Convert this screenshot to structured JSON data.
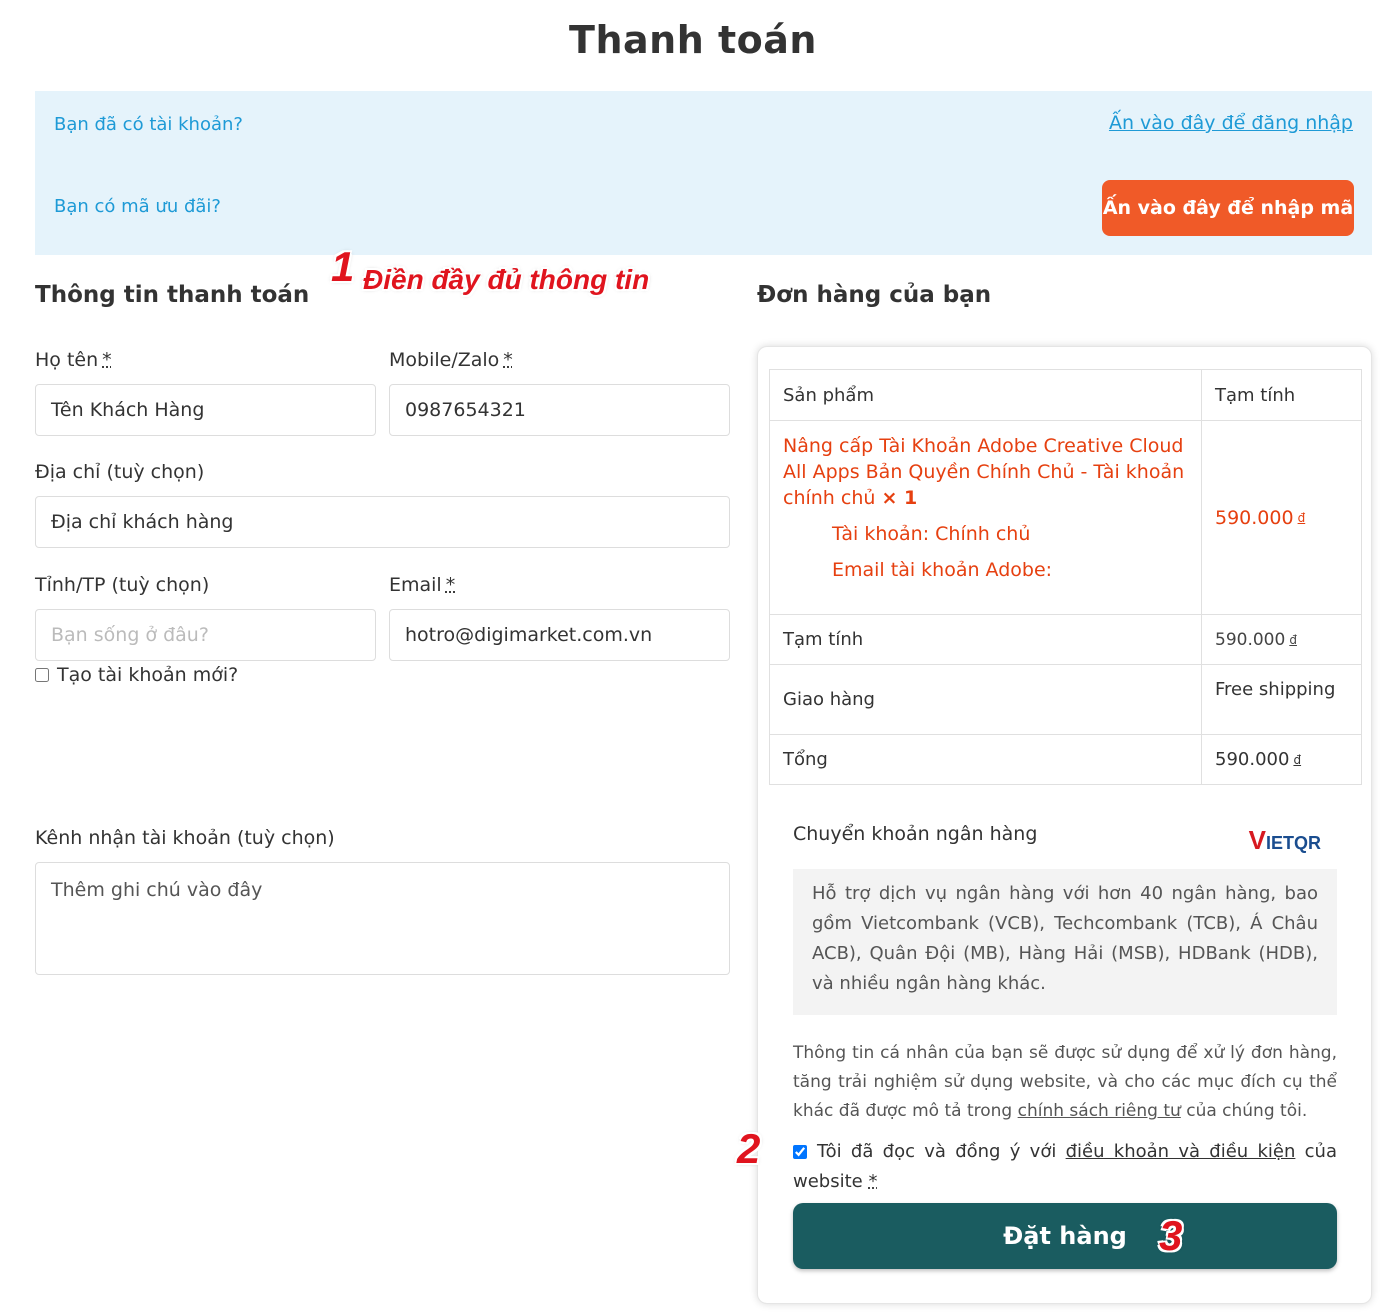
{
  "page": {
    "title": "Thanh toán"
  },
  "notices": {
    "login_question": "Bạn đã có tài khoản?",
    "login_link": "Ấn vào đây để đăng nhập",
    "coupon_question": "Bạn có mã ưu đãi?",
    "coupon_button": "Ấn vào đây để nhập mã"
  },
  "annotations": {
    "step1_number": "1",
    "step1_text": "Điền đầy đủ thông tin",
    "step2_number": "2",
    "step3_number": "3"
  },
  "billing": {
    "heading": "Thông tin thanh toán",
    "name_label": "Họ tên",
    "name_value": "Tên Khách Hàng",
    "phone_label": "Mobile/Zalo",
    "phone_value": "0987654321",
    "address_label": "Địa chỉ (tuỳ chọn)",
    "address_value": "Địa chỉ khách hàng",
    "city_label": "Tỉnh/TP (tuỳ chọn)",
    "city_placeholder": "Bạn sống ở đâu?",
    "email_label": "Email",
    "email_value": "hotro@digimarket.com.vn",
    "create_account_label": "Tạo tài khoản mới?",
    "channel_label": "Kênh nhận tài khoản (tuỳ chọn)",
    "notes_value": "Thêm ghi chú vào đây",
    "required_mark": "*"
  },
  "order": {
    "heading": "Đơn hàng của bạn",
    "col_product": "Sản phẩm",
    "col_subtotal": "Tạm tính",
    "product_name": "Nâng cấp Tài Khoản Adobe Creative Cloud All Apps Bản Quyền Chính Chủ - Tài khoản chính chủ",
    "product_qty": "× 1",
    "product_meta_1": "Tài khoản: Chính chủ",
    "product_meta_2": "Email tài khoản Adobe:",
    "product_price": "590.000",
    "currency": "đ",
    "subtotal_label": "Tạm tính",
    "subtotal_value": "590.000",
    "shipping_label": "Giao hàng",
    "shipping_value": "Free shipping",
    "total_label": "Tổng",
    "total_value": "590.000"
  },
  "payment": {
    "method_title": "Chuyển khoản ngân hàng",
    "logo_v": "V",
    "logo_rest": "IETQR",
    "description": "Hỗ trợ dịch vụ ngân hàng với hơn 40 ngân hàng, bao gồm Vietcombank (VCB), Techcombank (TCB), Á Châu ACB), Quân Đội (MB), Hàng Hải (MSB), HDBank (HDB), và nhiều ngân hàng khác.",
    "privacy_before": "Thông tin cá nhân của bạn sẽ được sử dụng để xử lý đơn hàng, tăng trải nghiệm sử dụng website, và cho các mục đích cụ thể khác đã được mô tả trong ",
    "privacy_link": "chính sách riêng tư",
    "privacy_after": " của chúng tôi.",
    "terms_before": "Tôi đã đọc và đồng ý với ",
    "terms_link": "điều khoản và điều kiện",
    "terms_after": " của website ",
    "terms_checked": true,
    "place_order": "Đặt hàng"
  },
  "colors": {
    "accent_blue": "#1e9ad6",
    "notice_bg": "#e5f3fb",
    "coupon_orange": "#f05a28",
    "product_red": "#e64010",
    "button_teal": "#1a5c60",
    "annotation_red": "#e0141e"
  }
}
